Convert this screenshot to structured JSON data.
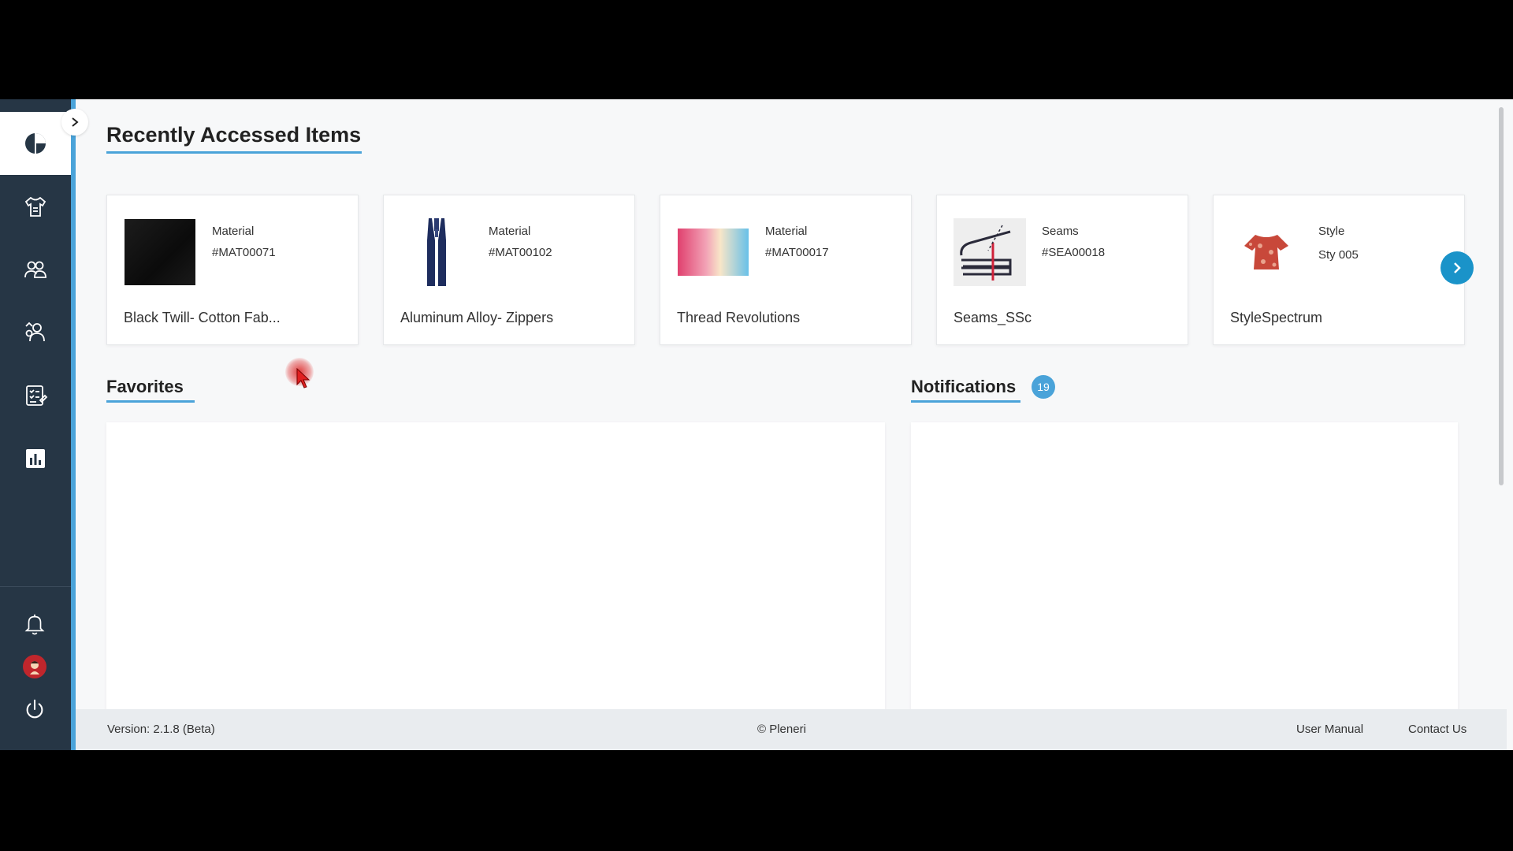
{
  "colors": {
    "sidebar": "#263645",
    "accent": "#4aa3d9",
    "next_button": "#1a93c9"
  },
  "sidebar": {
    "items": [
      {
        "icon": "pie-chart-icon",
        "active": true
      },
      {
        "icon": "garment-icon",
        "active": false
      },
      {
        "icon": "users-icon",
        "active": false
      },
      {
        "icon": "team-settings-icon",
        "active": false
      },
      {
        "icon": "checklist-icon",
        "active": false
      },
      {
        "icon": "bar-chart-icon",
        "active": false
      }
    ],
    "bottom": [
      {
        "icon": "bell-icon"
      },
      {
        "icon": "avatar-icon"
      },
      {
        "icon": "power-icon"
      }
    ]
  },
  "recent": {
    "title": "Recently Accessed Items",
    "items": [
      {
        "type": "Material",
        "code": "#MAT00071",
        "name": "Black Twill- Cotton Fab...",
        "thumb": "black-fabric"
      },
      {
        "type": "Material",
        "code": "#MAT00102",
        "name": "Aluminum Alloy- Zippers",
        "thumb": "navy-zipper"
      },
      {
        "type": "Material",
        "code": "#MAT00017",
        "name": "Thread Revolutions",
        "thumb": "gradient-swatch"
      },
      {
        "type": "Seams",
        "code": "#SEA00018",
        "name": "Seams_SSc",
        "thumb": "seam-diagram"
      },
      {
        "type": "Style",
        "code": "Sty 005",
        "name": "StyleSpectrum",
        "thumb": "floral-top"
      }
    ]
  },
  "favorites": {
    "title": "Favorites"
  },
  "notifications": {
    "title": "Notifications",
    "count": "19"
  },
  "footer": {
    "version": "Version: 2.1.8 (Beta)",
    "copyright": "© Pleneri",
    "user_manual": "User Manual",
    "contact": "Contact Us"
  }
}
